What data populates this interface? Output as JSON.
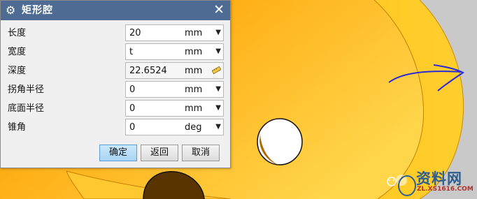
{
  "dialog": {
    "title": "矩形腔",
    "fields": [
      {
        "label": "长度",
        "value": "20",
        "unit": "mm"
      },
      {
        "label": "宽度",
        "value": "t",
        "unit": "mm"
      },
      {
        "label": "深度",
        "value": "22.6524",
        "unit": "mm"
      },
      {
        "label": "拐角半径",
        "value": "0",
        "unit": "mm"
      },
      {
        "label": "底面半径",
        "value": "0",
        "unit": "mm"
      },
      {
        "label": "锥角",
        "value": "0",
        "unit": "deg"
      }
    ],
    "buttons": {
      "ok": "确定",
      "back": "返回",
      "cancel": "取消"
    }
  },
  "watermark": {
    "text": "资料网",
    "url": "ZL.XS1616.COM"
  },
  "colors": {
    "part_orange": "#f5a800",
    "part_yellow": "#ffd24a",
    "title_bar": "#4d6b93",
    "annotation_blue": "#2a2ad8"
  }
}
